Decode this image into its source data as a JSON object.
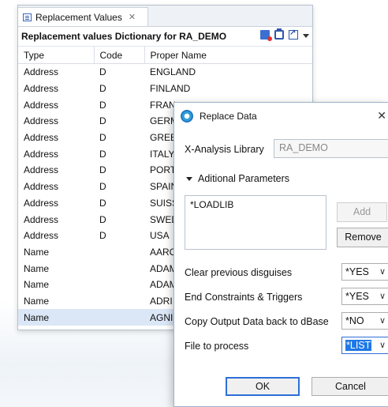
{
  "view": {
    "tab_label": "Replacement Values",
    "tab_close": "✕",
    "title": "Replacement values Dictionary for RA_DEMO",
    "columns": [
      "Type",
      "Code",
      "Proper Name"
    ],
    "rows": [
      [
        "Address",
        "D",
        "ENGLAND"
      ],
      [
        "Address",
        "D",
        "FINLAND"
      ],
      [
        "Address",
        "D",
        "FRAN"
      ],
      [
        "Address",
        "D",
        "GERM"
      ],
      [
        "Address",
        "D",
        "GREE"
      ],
      [
        "Address",
        "D",
        "ITALY"
      ],
      [
        "Address",
        "D",
        "PORT"
      ],
      [
        "Address",
        "D",
        "SPAIN"
      ],
      [
        "Address",
        "D",
        "SUISS"
      ],
      [
        "Address",
        "D",
        "SWED"
      ],
      [
        "Address",
        "D",
        "USA"
      ],
      [
        "Name",
        "",
        "AARO"
      ],
      [
        "Name",
        "",
        "ADAM"
      ],
      [
        "Name",
        "",
        "ADAM"
      ],
      [
        "Name",
        "",
        "ADRI"
      ],
      [
        "Name",
        "",
        "AGNI"
      ]
    ]
  },
  "dialog": {
    "title": "Replace Data",
    "close": "✕",
    "library_label": "X-Analysis Library",
    "library_value": "RA_DEMO",
    "section_label": "Aditional Parameters",
    "list_items": [
      "*LOADLIB"
    ],
    "add_label": "Add",
    "remove_label": "Remove",
    "clear_label": "Clear previous disguises",
    "clear_value": "*YES",
    "end_label": "End Constraints & Triggers",
    "end_value": "*YES",
    "copy_label": "Copy Output Data back to dBase",
    "copy_value": "*NO",
    "file_label": "File to process",
    "file_value": "*LIST",
    "ok_label": "OK",
    "cancel_label": "Cancel"
  }
}
